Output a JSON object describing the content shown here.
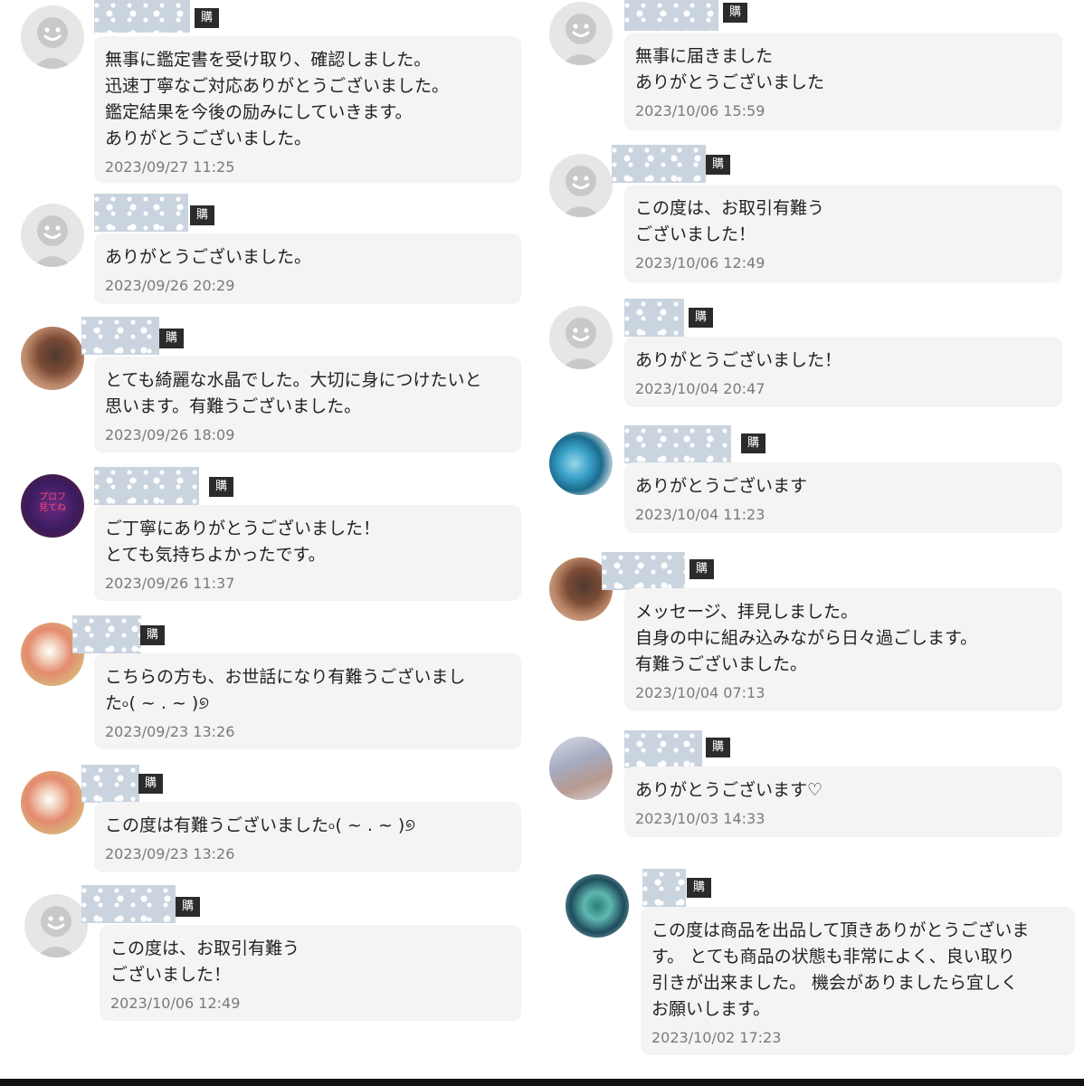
{
  "badge_label": "購入者",
  "left_reviews": [
    {
      "avatar": "default-avatar",
      "message": "無事に鑑定書を受け取り、確認しました。\n迅速丁寧なご対応ありがとうございました。\n鑑定結果を今後の励みにしていきます。\nありがとうございました。",
      "date": "2023/09/27 11:25"
    },
    {
      "avatar": "default-avatar",
      "message": "ありがとうございました。",
      "date": "2023/09/26 20:29"
    },
    {
      "avatar": "crystal-avatar",
      "message": "とても綺麗な水晶でした。大切に身につけたいと\n思います。有難うございました。",
      "date": "2023/09/26 18:09"
    },
    {
      "avatar": "profile-text-avatar",
      "avatar_text": "プロフ\n見てね",
      "message": "ご丁寧にありがとうございました！\nとても気持ちよかったです。",
      "date": "2023/09/26 11:37"
    },
    {
      "avatar": "flower-avatar",
      "message": "こちらの方も、お世話になり有難うございまし\nた৹( ~ . ~ )୭",
      "date": "2023/09/23 13:26"
    },
    {
      "avatar": "flower-avatar",
      "message": "この度は有難うございました৹( ~ . ~ )୭",
      "date": "2023/09/23 13:26"
    },
    {
      "avatar": "default-avatar",
      "message": "この度は、お取引有難う\nございました！",
      "date": "2023/10/06 12:49"
    }
  ],
  "right_reviews": [
    {
      "avatar": "default-avatar",
      "message": "無事に届きました\nありがとうございました",
      "date": "2023/10/06 15:59"
    },
    {
      "avatar": "default-avatar",
      "message": "この度は、お取引有難う\nございました！",
      "date": "2023/10/06 12:49"
    },
    {
      "avatar": "default-avatar",
      "message": "ありがとうございました！",
      "date": "2023/10/04 20:47"
    },
    {
      "avatar": "crystal-avatar",
      "message": "ありがとうございます",
      "date": "2023/10/04 11:23"
    },
    {
      "avatar": "crystal-avatar",
      "message": "メッセージ、拝見しました。\n自身の中に組み込みながら日々過ごします。\n有難うございました。",
      "date": "2023/10/04 07:13"
    },
    {
      "avatar": "cloud-avatar",
      "message": "ありがとうございます♡",
      "date": "2023/10/03 14:33"
    },
    {
      "avatar": "teal-avatar",
      "message": "この度は商品を出品して頂きありがとうございま\nす。 とても商品の状態も非常によく、良い取り\n引きが出来ました。 機会がありましたら宜しく\nお願いします。",
      "date": "2023/10/02 17:23"
    }
  ]
}
